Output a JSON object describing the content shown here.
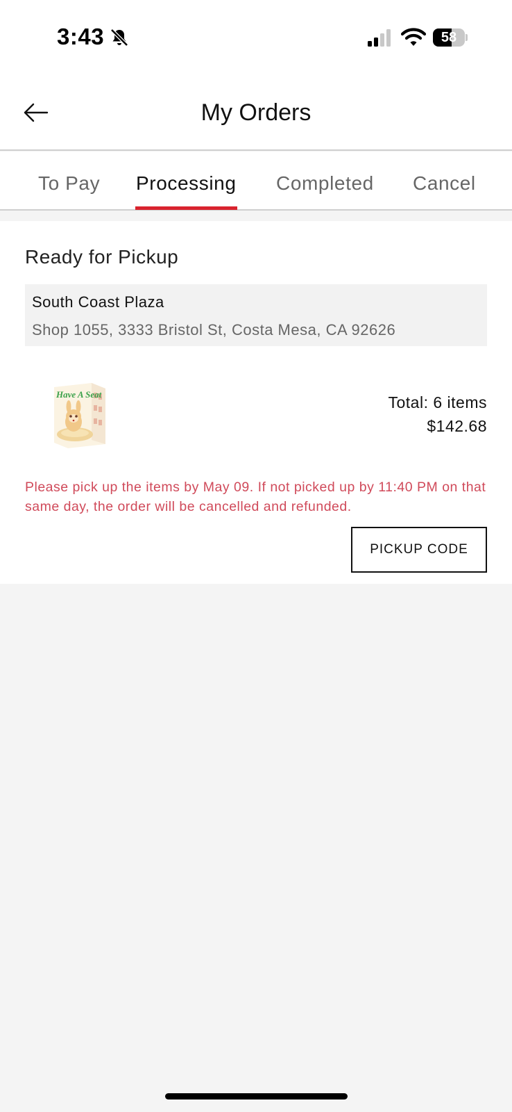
{
  "status_bar": {
    "time": "3:43",
    "battery_level": "58",
    "battery_percent": 58,
    "icons": [
      "bell-slash-icon",
      "cellular-signal-icon",
      "wifi-icon",
      "battery-icon"
    ]
  },
  "header": {
    "title": "My Orders",
    "back_icon": "arrow-left-icon"
  },
  "tabs": [
    {
      "label": "To Pay",
      "active": false
    },
    {
      "label": "Processing",
      "active": true
    },
    {
      "label": "Completed",
      "active": false
    },
    {
      "label": "Cancel",
      "active": false
    }
  ],
  "order": {
    "status": "Ready for Pickup",
    "store": {
      "name": "South Coast Plaza",
      "address": "Shop 1055, 3333 Bristol St, Costa Mesa, CA 92626"
    },
    "product_image_text": "Have A Seat",
    "total_items": "Total: 6 items",
    "total_price": "$142.68",
    "notice": "Please pick up the items by May 09. If not picked up by 11:40 PM on that same day, the order will be cancelled and refunded.",
    "pickup_code_label": "PICKUP CODE"
  },
  "colors": {
    "accent": "#d9232e",
    "notice_text": "#d04a5a",
    "background": "#f4f4f4"
  }
}
